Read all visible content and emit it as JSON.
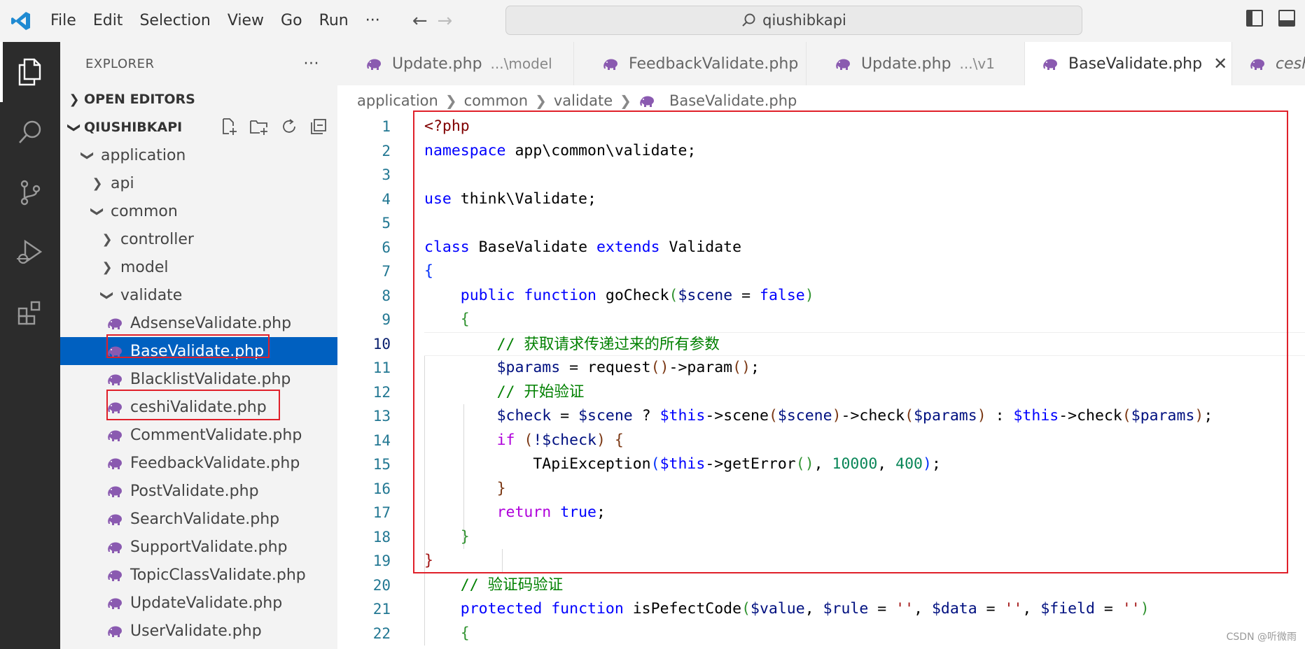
{
  "titlebar": {
    "menu": [
      "File",
      "Edit",
      "Selection",
      "View",
      "Go",
      "Run",
      "···"
    ],
    "back": "←",
    "forward": "→",
    "search_text": "qiushibkapi"
  },
  "sidebar": {
    "title": "EXPLORER",
    "more": "···",
    "open_editors": "OPEN EDITORS",
    "workspace": "QIUSHIBKAPI",
    "tree": [
      {
        "label": "application",
        "type": "folder",
        "expanded": true,
        "depth": 1
      },
      {
        "label": "api",
        "type": "folder",
        "expanded": false,
        "depth": 2
      },
      {
        "label": "common",
        "type": "folder",
        "expanded": true,
        "depth": 2
      },
      {
        "label": "controller",
        "type": "folder",
        "expanded": false,
        "depth": 3
      },
      {
        "label": "model",
        "type": "folder",
        "expanded": false,
        "depth": 3
      },
      {
        "label": "validate",
        "type": "folder",
        "expanded": true,
        "depth": 3
      },
      {
        "label": "AdsenseValidate.php",
        "type": "file",
        "depth": 4
      },
      {
        "label": "BaseValidate.php",
        "type": "file",
        "depth": 4,
        "selected": true
      },
      {
        "label": "BlacklistValidate.php",
        "type": "file",
        "depth": 4
      },
      {
        "label": "ceshiValidate.php",
        "type": "file",
        "depth": 4
      },
      {
        "label": "CommentValidate.php",
        "type": "file",
        "depth": 4
      },
      {
        "label": "FeedbackValidate.php",
        "type": "file",
        "depth": 4
      },
      {
        "label": "PostValidate.php",
        "type": "file",
        "depth": 4
      },
      {
        "label": "SearchValidate.php",
        "type": "file",
        "depth": 4
      },
      {
        "label": "SupportValidate.php",
        "type": "file",
        "depth": 4
      },
      {
        "label": "TopicClassValidate.php",
        "type": "file",
        "depth": 4
      },
      {
        "label": "UpdateValidate.php",
        "type": "file",
        "depth": 4
      },
      {
        "label": "UserValidate.php",
        "type": "file",
        "depth": 4
      }
    ]
  },
  "tabs": [
    {
      "label": "Update.php",
      "desc": "...\\model",
      "active": false
    },
    {
      "label": "FeedbackValidate.php",
      "desc": "",
      "active": false
    },
    {
      "label": "Update.php",
      "desc": "...\\v1",
      "active": false
    },
    {
      "label": "BaseValidate.php",
      "desc": "",
      "active": true,
      "close": "✕"
    },
    {
      "label": "ceshiVa",
      "desc": "",
      "active": false
    }
  ],
  "breadcrumb": [
    "application",
    "common",
    "validate",
    "BaseValidate.php"
  ],
  "editor": {
    "line_numbers": [
      "1",
      "2",
      "3",
      "4",
      "5",
      "6",
      "7",
      "8",
      "9",
      "10",
      "11",
      "12",
      "13",
      "14",
      "15",
      "16",
      "17",
      "18",
      "19",
      "20",
      "21",
      "22"
    ],
    "current_line": "10",
    "code": {
      "l1_open": "<?php",
      "l2_ns": "namespace",
      "l2_path": " app\\common\\validate;",
      "l4_use": "use",
      "l4_path": " think\\Validate;",
      "l6_class": "class",
      "l6_name": " BaseValidate ",
      "l6_extends": "extends",
      "l6_parent": " Validate",
      "l7_brace": "{",
      "l8_public": "public",
      "l8_function": "function",
      "l8_name": " goCheck",
      "l8_paren_open": "(",
      "l8_var": "$scene",
      "l8_eq": " = ",
      "l8_false": "false",
      "l8_paren_close": ")",
      "l9_brace": "{",
      "l10_comment": "// 获取请求传递过来的所有参数",
      "l11_var": "$params",
      "l11_eq": " = request",
      "l11_p1": "()",
      "l11_mid": "->param",
      "l11_p2": "()",
      "l11_end": ";",
      "l12_comment": "// 开始验证",
      "l13_var": "$check",
      "l13_eq": " = ",
      "l13_scene": "$scene",
      "l13_q": " ? ",
      "l13_this1": "$this",
      "l13_m1": "->scene",
      "l13_po1": "(",
      "l13_a1": "$scene",
      "l13_pc1": ")",
      "l13_m2": "->check",
      "l13_po2": "(",
      "l13_a2": "$params",
      "l13_pc2": ")",
      "l13_colon": " : ",
      "l13_this2": "$this",
      "l13_m3": "->check",
      "l13_po3": "(",
      "l13_a3": "$params",
      "l13_pc3": ")",
      "l13_end": ";",
      "l14_if": "if",
      "l14_po": " (",
      "l14_cond": "!$check",
      "l14_pc": ")",
      "l14_brace": " {",
      "l15_fn": "TApiException",
      "l15_po": "(",
      "l15_this": "$this",
      "l15_m": "->getError",
      "l15_pp": "()",
      "l15_c1": ", ",
      "l15_n1": "10000",
      "l15_c2": ", ",
      "l15_n2": "400",
      "l15_pc": ")",
      "l15_end": ";",
      "l16_brace": "}",
      "l17_return": "return",
      "l17_true": "true",
      "l17_end": ";",
      "l18_brace": "}",
      "l19_brace": "}",
      "l20_comment": "// 验证码验证",
      "l21_protected": "protected",
      "l21_function": "function",
      "l21_name": " isPefectCode",
      "l21_po": "(",
      "l21_v1": "$value",
      "l21_c1": ", ",
      "l21_v2": "$rule",
      "l21_eq2": " = ",
      "l21_s2": "''",
      "l21_c2": ", ",
      "l21_v3": "$data",
      "l21_eq3": " = ",
      "l21_s3": "''",
      "l21_c3": ", ",
      "l21_v4": "$field",
      "l21_eq4": " = ",
      "l21_s4": "''",
      "l21_pc": ")",
      "l22_brace": "{"
    }
  },
  "watermark": "CSDN @听微雨",
  "colors": {
    "accent": "#0060c0",
    "highlight_box": "#e0202a",
    "php_icon": "#8a5ab0"
  }
}
